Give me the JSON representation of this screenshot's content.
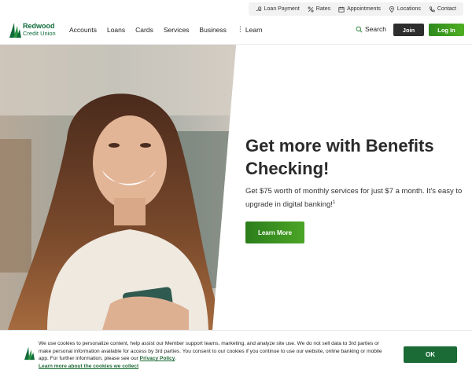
{
  "utility_bar": {
    "items": [
      {
        "label": "Loan Payment",
        "icon": "hand-coin-icon"
      },
      {
        "label": "Rates",
        "icon": "percent-icon"
      },
      {
        "label": "Appointments",
        "icon": "calendar-icon"
      },
      {
        "label": "Locations",
        "icon": "map-pin-icon"
      },
      {
        "label": "Contact",
        "icon": "phone-icon"
      }
    ]
  },
  "brand": {
    "name_line1": "Redwood",
    "name_line2": "Credit Union",
    "color": "#0f6b3a"
  },
  "nav": {
    "items": [
      "Accounts",
      "Loans",
      "Cards",
      "Services",
      "Business",
      "Learn"
    ],
    "search_label": "Search",
    "join_label": "Join",
    "login_label": "Log In"
  },
  "hero": {
    "title": "Get more with Benefits Checking!",
    "body": "Get $75 worth of monthly services for just $7 a month. It's easy to upgrade in digital banking!",
    "footnote": "1",
    "cta_label": "Learn More",
    "accent": "#3a9a22"
  },
  "cookie_banner": {
    "text": "We use cookies to personalize content, help assist our Member support teams, marketing, and analyze site use. We do not sell data to 3rd parties or make personal information available for access by 3rd parties. You consent to our cookies if you continue to use our website, online banking or mobile app. For further information, please see our",
    "privacy_link": "Privacy Policy",
    "learn_link": "Learn more about the cookies we collect",
    "ok_label": "OK",
    "button_color": "#1a6b36"
  }
}
